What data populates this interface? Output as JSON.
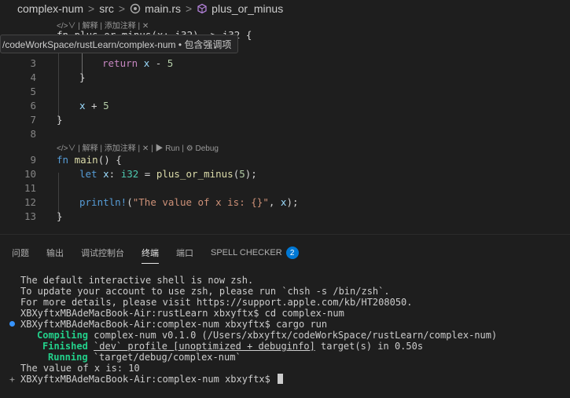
{
  "breadcrumb": {
    "project": "complex-num",
    "folder": "src",
    "file": "main.rs",
    "symbol": "plus_or_minus",
    "separator": ">"
  },
  "editor": {
    "lens1": "</>∨ | 解释 | 添加注释 | ✕",
    "lens2": "</>∨ | 解释 | 添加注释 | ✕ | ▶ Run | ⚙ Debug",
    "hidden_line": "fn plus_or_minus(x: i32) -> i32 {",
    "lines": [
      {
        "n": "3",
        "text": "return x - 5"
      },
      {
        "n": "4",
        "text": "}"
      },
      {
        "n": "5",
        "text": ""
      },
      {
        "n": "6",
        "text": "x + 5"
      },
      {
        "n": "7",
        "text": "}"
      },
      {
        "n": "8",
        "text": ""
      },
      {
        "n": "9",
        "text": "fn main() {"
      },
      {
        "n": "10",
        "text": "let x: i32 = plus_or_minus(5);"
      },
      {
        "n": "11",
        "text": ""
      },
      {
        "n": "12",
        "text": "println!(\"The value of x is: {}\", x);"
      },
      {
        "n": "13",
        "text": "}"
      }
    ]
  },
  "tooltip": {
    "text": "/codeWorkSpace/rustLearn/complex-num • 包含强调项"
  },
  "panel": {
    "tabs": [
      "问题",
      "输出",
      "调试控制台",
      "终端",
      "端口",
      "SPELL CHECKER"
    ],
    "active_tab": "终端",
    "spell_checker_count": "2"
  },
  "terminal": {
    "line1": "The default interactive shell is now zsh.",
    "line2": "To update your account to use zsh, please run `chsh -s /bin/zsh`.",
    "line3": "For more details, please visit https://support.apple.com/kb/HT208050.",
    "line4": "XBXyftxMBAdeMacBook-Air:rustLearn xbxyftx$ cd complex-num",
    "line5": "XBXyftxMBAdeMacBook-Air:complex-num xbxyftx$ cargo run",
    "compiling_label": "Compiling",
    "compiling_text": "complex-num v0.1.0 (/Users/xbxyftx/codeWorkSpace/rustLearn/complex-num)",
    "finished_label": "Finished",
    "finished_profile": "`dev` profile [unoptimized + debuginfo]",
    "finished_text": "target(s) in 0.50s",
    "running_label": "Running",
    "running_text": "`target/debug/complex-num`",
    "output": "The value of x is: 10",
    "prompt": "XBXyftxMBAdeMacBook-Air:complex-num xbxyftx$"
  },
  "colors": {
    "accent": "#0078d4",
    "green": "#23d18b",
    "cyan": "#29b8db"
  }
}
